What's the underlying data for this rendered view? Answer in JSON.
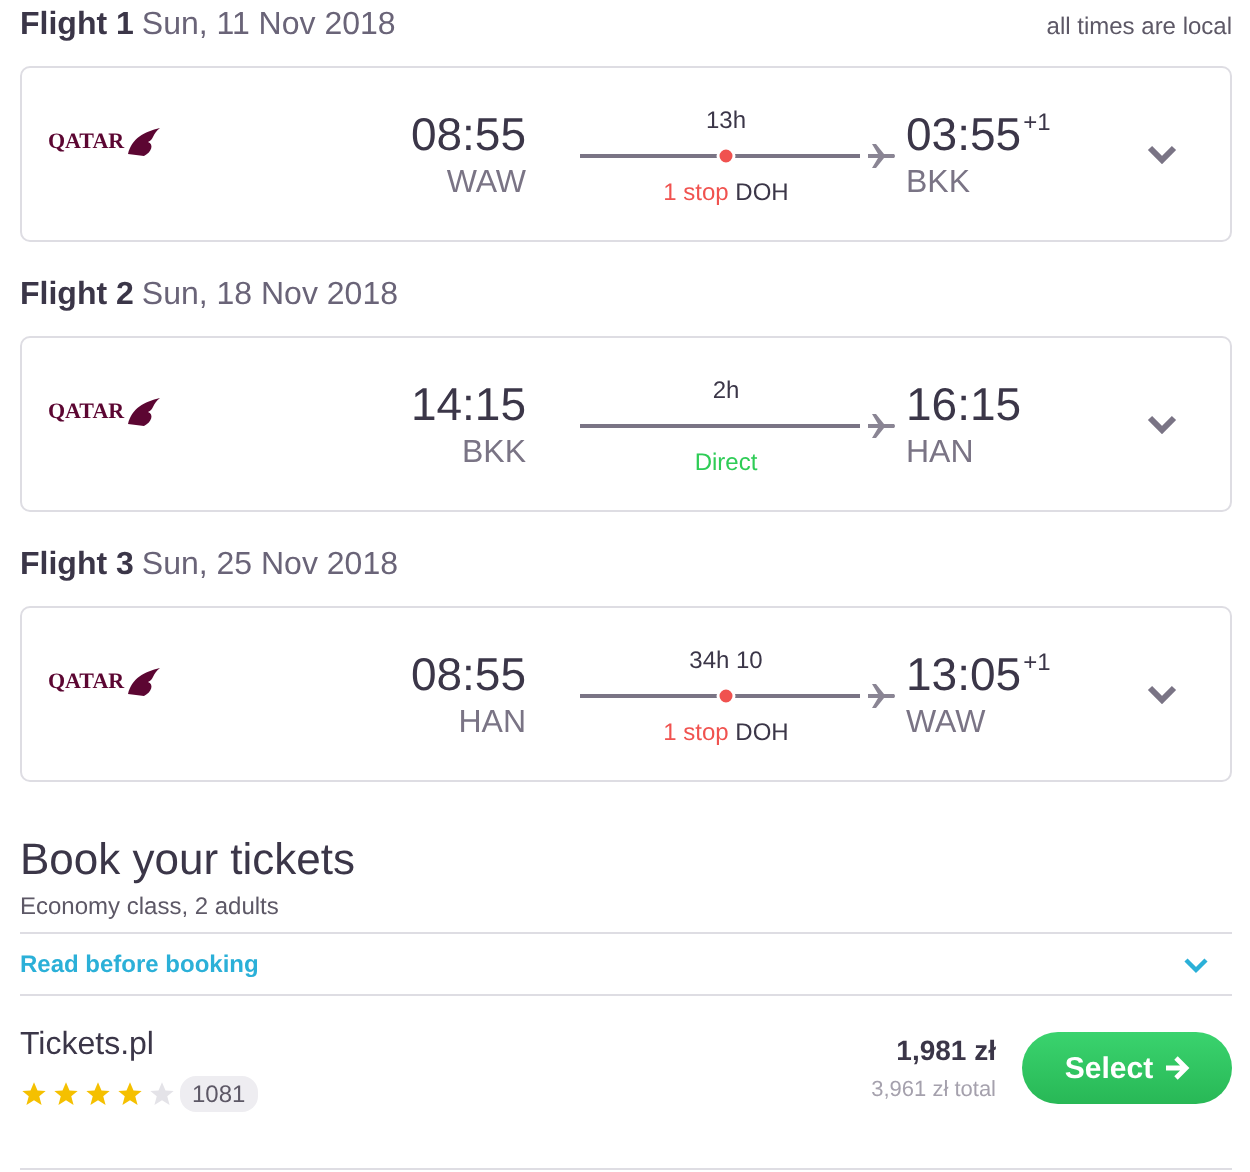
{
  "note": "all times are local",
  "flights": [
    {
      "label": "Flight 1",
      "date": "Sun, 11 Nov 2018",
      "airline_logo": "QATAR",
      "depart_time": "08:55",
      "depart_airport": "WAW",
      "duration": "13h",
      "kind": "stop",
      "stops": "1 stop",
      "via": "DOH",
      "arrive_time": "03:55",
      "day_offset": "+1",
      "arrive_airport": "BKK"
    },
    {
      "label": "Flight 2",
      "date": "Sun, 18 Nov 2018",
      "airline_logo": "QATAR",
      "depart_time": "14:15",
      "depart_airport": "BKK",
      "duration": "2h",
      "kind": "direct",
      "stops": "Direct",
      "arrive_time": "16:15",
      "arrive_airport": "HAN"
    },
    {
      "label": "Flight 3",
      "date": "Sun, 25 Nov 2018",
      "airline_logo": "QATAR",
      "depart_time": "08:55",
      "depart_airport": "HAN",
      "duration": "34h 10",
      "kind": "stop",
      "stops": "1 stop",
      "via": "DOH",
      "arrive_time": "13:05",
      "day_offset": "+1",
      "arrive_airport": "WAW"
    }
  ],
  "booking": {
    "title": "Book your tickets",
    "subtitle": "Economy class, 2 adults",
    "read_link": "Read before booking",
    "offers": [
      {
        "provider": "Tickets.pl",
        "stars": 4,
        "reviews": "1081",
        "price": "1,981 zł",
        "total": "3,961 zł total",
        "button": "Select"
      }
    ]
  }
}
